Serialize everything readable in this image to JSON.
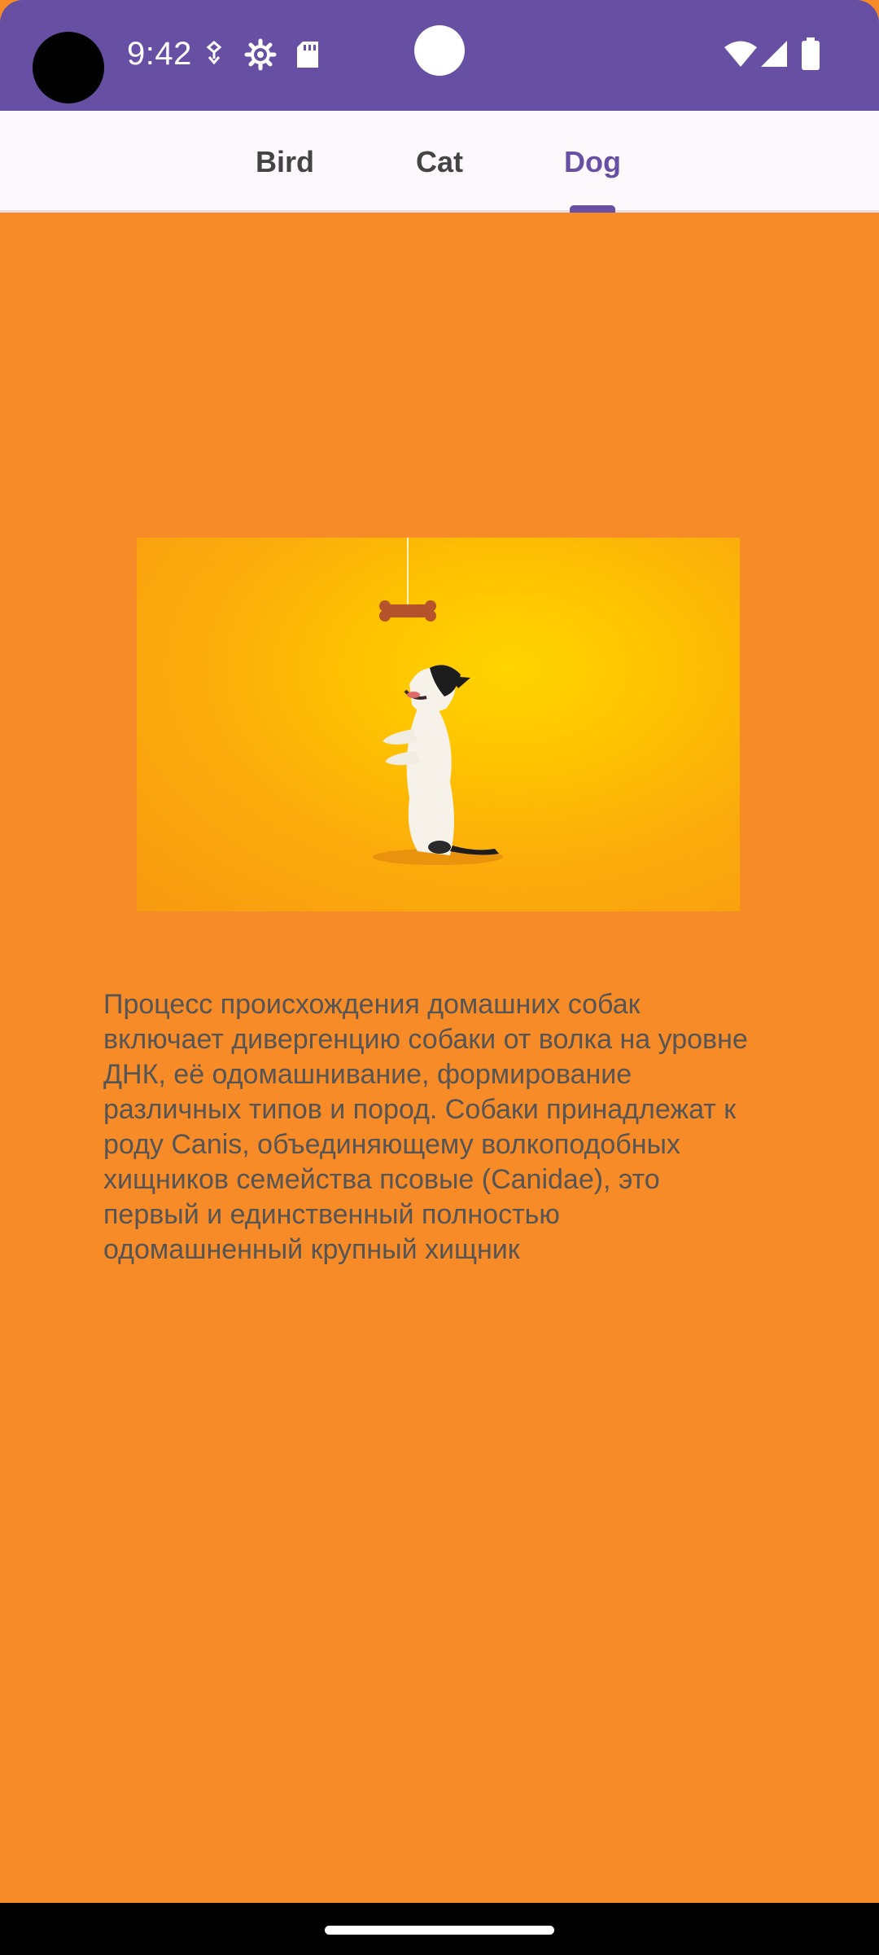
{
  "status_bar": {
    "time": "9:42",
    "icons_left": [
      "vpn-key-icon",
      "settings-gear-icon",
      "sd-card-icon"
    ],
    "icons_right": [
      "wifi-icon",
      "cell-signal-icon",
      "battery-icon"
    ],
    "color": "#6750a4"
  },
  "tabs": [
    {
      "label": "Bird",
      "selected": false
    },
    {
      "label": "Cat",
      "selected": false
    },
    {
      "label": "Dog",
      "selected": true
    }
  ],
  "content": {
    "background": "#f78b28",
    "image": "dog-begging-treat-photo",
    "description": "Процесс происхождения домашних собак включает дивергенцию собаки от волка на уровне ДНК, её одомашнивание, формирование различных типов и пород. Собаки принадлежат к роду Canis, объединяющему волкоподобных хищников семейства псовые (Canidae), это первый и единственный полностью одомашненный крупный хищник"
  },
  "colors": {
    "accent": "#6750a4",
    "tab_bar_bg": "#fdf8fc"
  }
}
